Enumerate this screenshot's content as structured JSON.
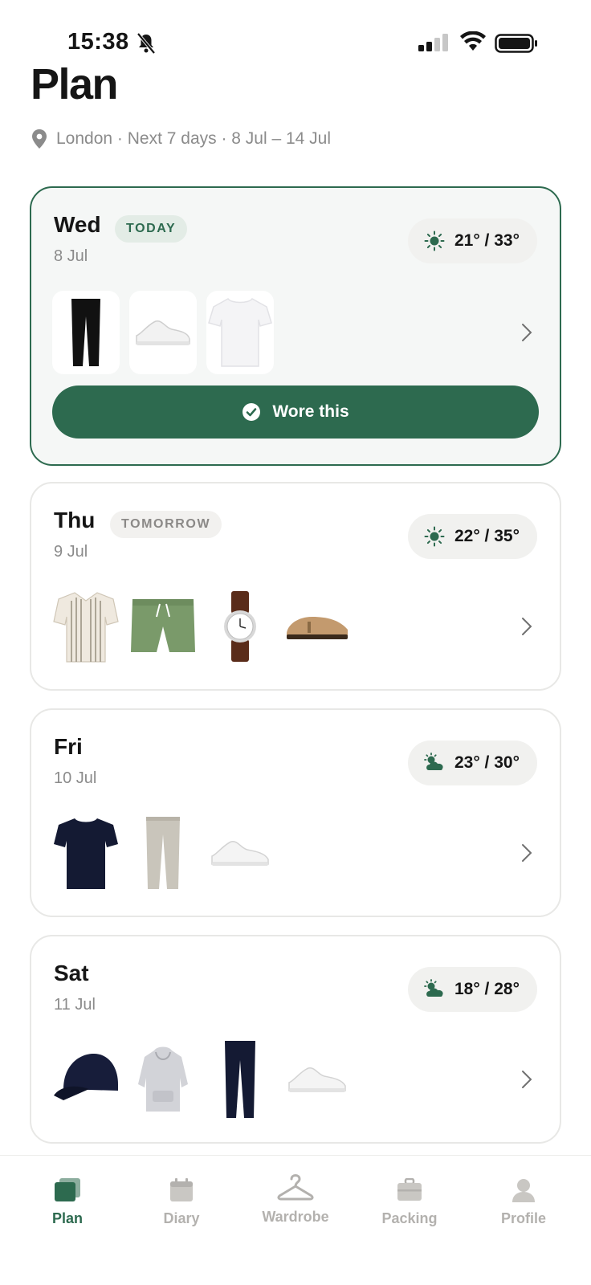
{
  "status_bar": {
    "time": "15:38"
  },
  "header": {
    "title": "Plan",
    "location": "London · Next 7 days · 8 Jul – 14 Jul"
  },
  "days": [
    {
      "day": "Wed",
      "date": "8 Jul",
      "badge": "TODAY",
      "weather": "21° / 33°",
      "weather_icon": "sun-icon",
      "items": [
        "black-trousers",
        "white-sneakers",
        "white-tshirt"
      ],
      "action": "Wore this"
    },
    {
      "day": "Thu",
      "date": "9 Jul",
      "badge": "TOMORROW",
      "weather": "22° / 35°",
      "weather_icon": "sun-icon",
      "items": [
        "striped-shirt",
        "green-shorts",
        "watch",
        "clogs"
      ]
    },
    {
      "day": "Fri",
      "date": "10 Jul",
      "weather": "23° / 30°",
      "weather_icon": "partly-cloudy-icon",
      "items": [
        "navy-tshirt",
        "beige-chinos",
        "white-sneakers"
      ]
    },
    {
      "day": "Sat",
      "date": "11 Jul",
      "weather": "18° / 28°",
      "weather_icon": "partly-cloudy-icon",
      "items": [
        "navy-cap",
        "grey-hoodie",
        "navy-trousers",
        "white-sneakers"
      ]
    }
  ],
  "tabs": [
    {
      "label": "Plan",
      "icon": "plan-icon",
      "active": true
    },
    {
      "label": "Diary",
      "icon": "calendar-icon"
    },
    {
      "label": "Wardrobe",
      "icon": "hanger-icon"
    },
    {
      "label": "Packing",
      "icon": "suitcase-icon"
    },
    {
      "label": "Profile",
      "icon": "person-icon"
    }
  ],
  "colors": {
    "accent": "#2d6a4f",
    "muted": "#8b8b8b",
    "card_border": "#e8e8e6"
  }
}
